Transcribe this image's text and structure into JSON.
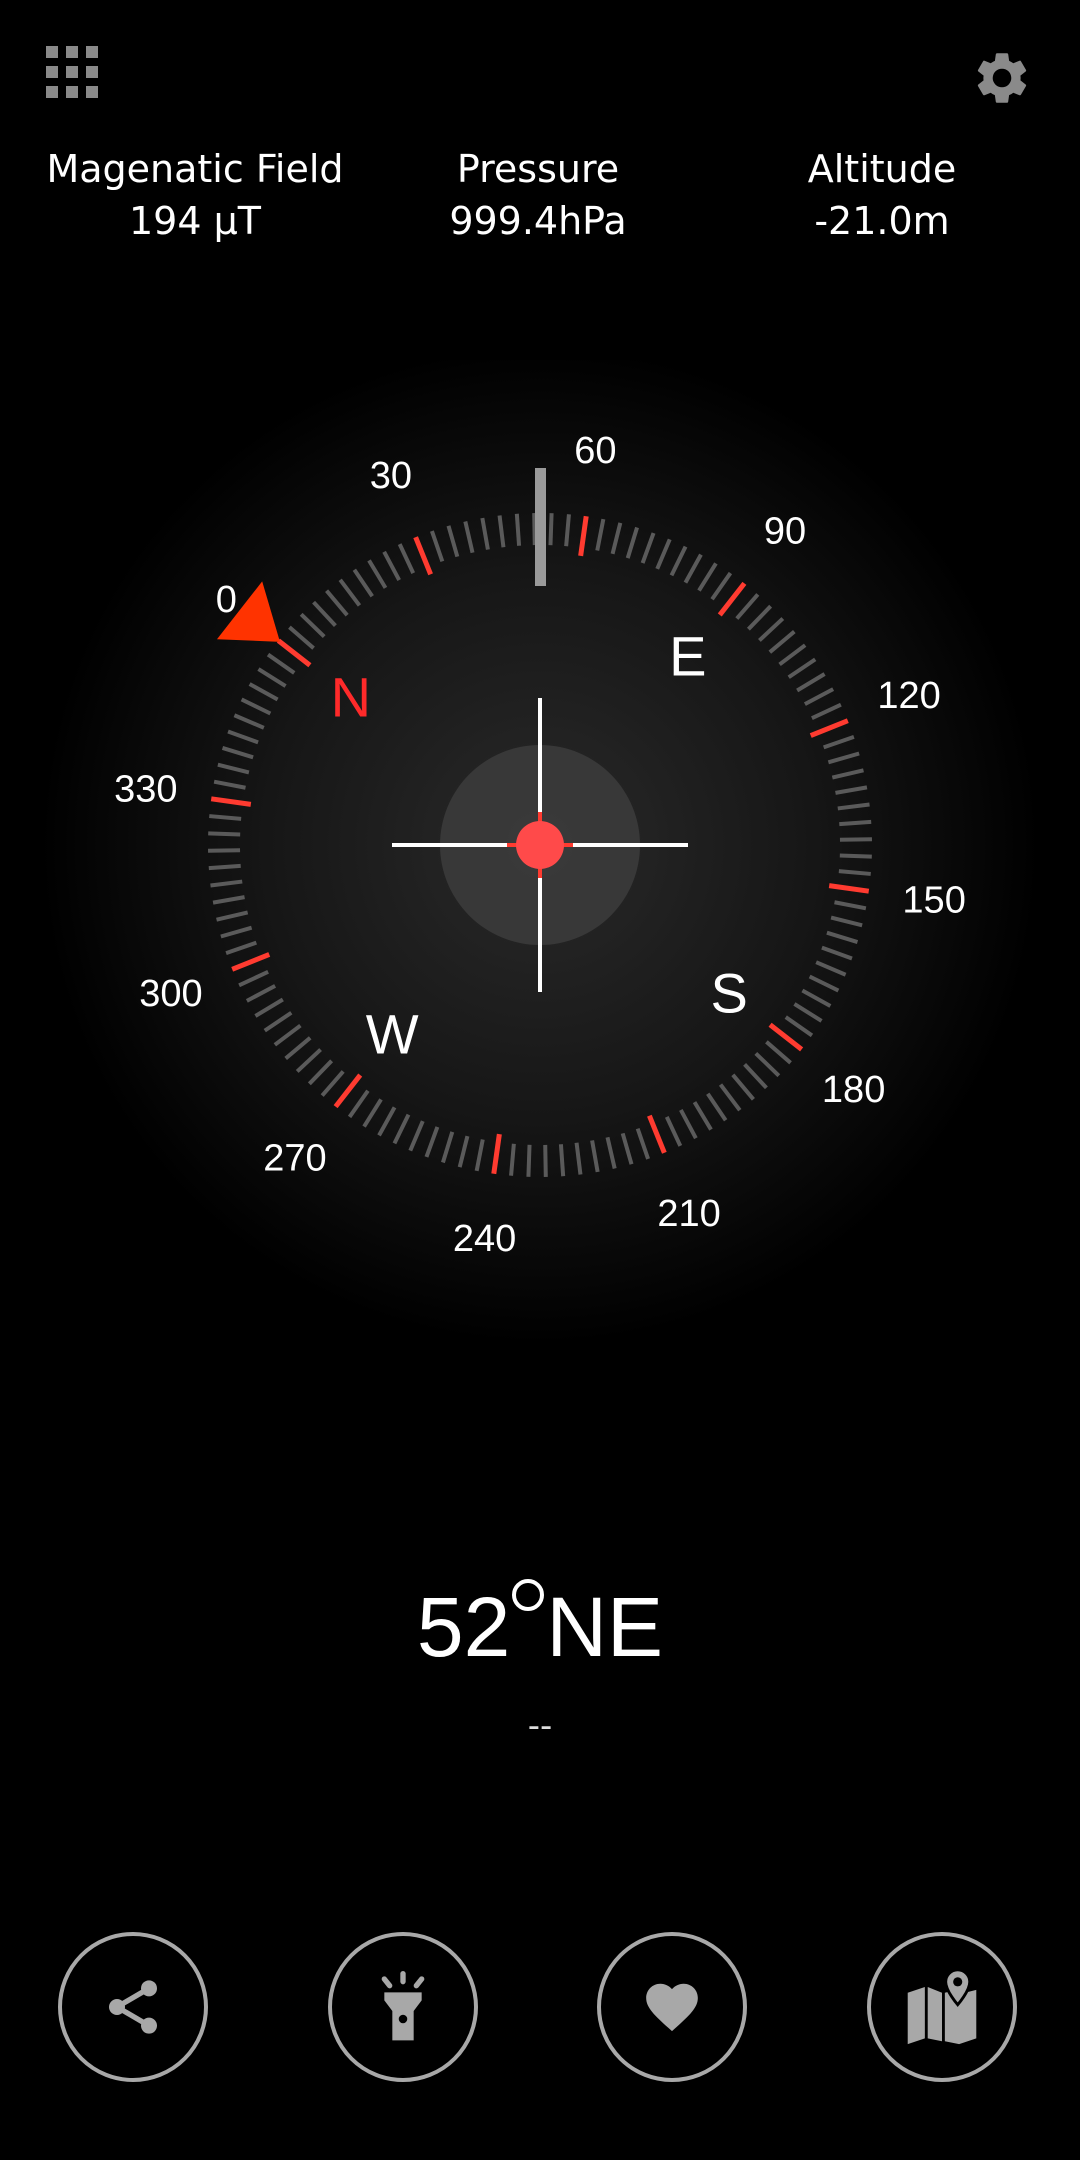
{
  "header": {
    "menu_icon": "grid-menu-icon",
    "settings_icon": "gear-icon"
  },
  "stats": {
    "magnetic": {
      "label": "Magenatic Field",
      "value": "194 µT"
    },
    "pressure": {
      "label": "Pressure",
      "value": "999.4hPa"
    },
    "altitude": {
      "label": "Altitude",
      "value": "-21.0m"
    }
  },
  "compass": {
    "heading_deg": 52,
    "dial_labels": [
      "0",
      "30",
      "60",
      "90",
      "120",
      "150",
      "180",
      "210",
      "240",
      "270",
      "300",
      "330"
    ],
    "cardinals": {
      "n": "N",
      "e": "E",
      "s": "S",
      "w": "W"
    },
    "colors": {
      "accent": "#ff3b30",
      "north": "#ff2a2a",
      "pointer": "#ff3300",
      "tick": "#5a5a5a",
      "text": "#ffffff"
    }
  },
  "reading": {
    "degrees": "52",
    "direction": "NE",
    "subtext": "--"
  },
  "actions": {
    "share_icon": "share-icon",
    "flashlight_icon": "flashlight-icon",
    "favorite_icon": "heart-icon",
    "map_icon": "map-pin-icon"
  }
}
